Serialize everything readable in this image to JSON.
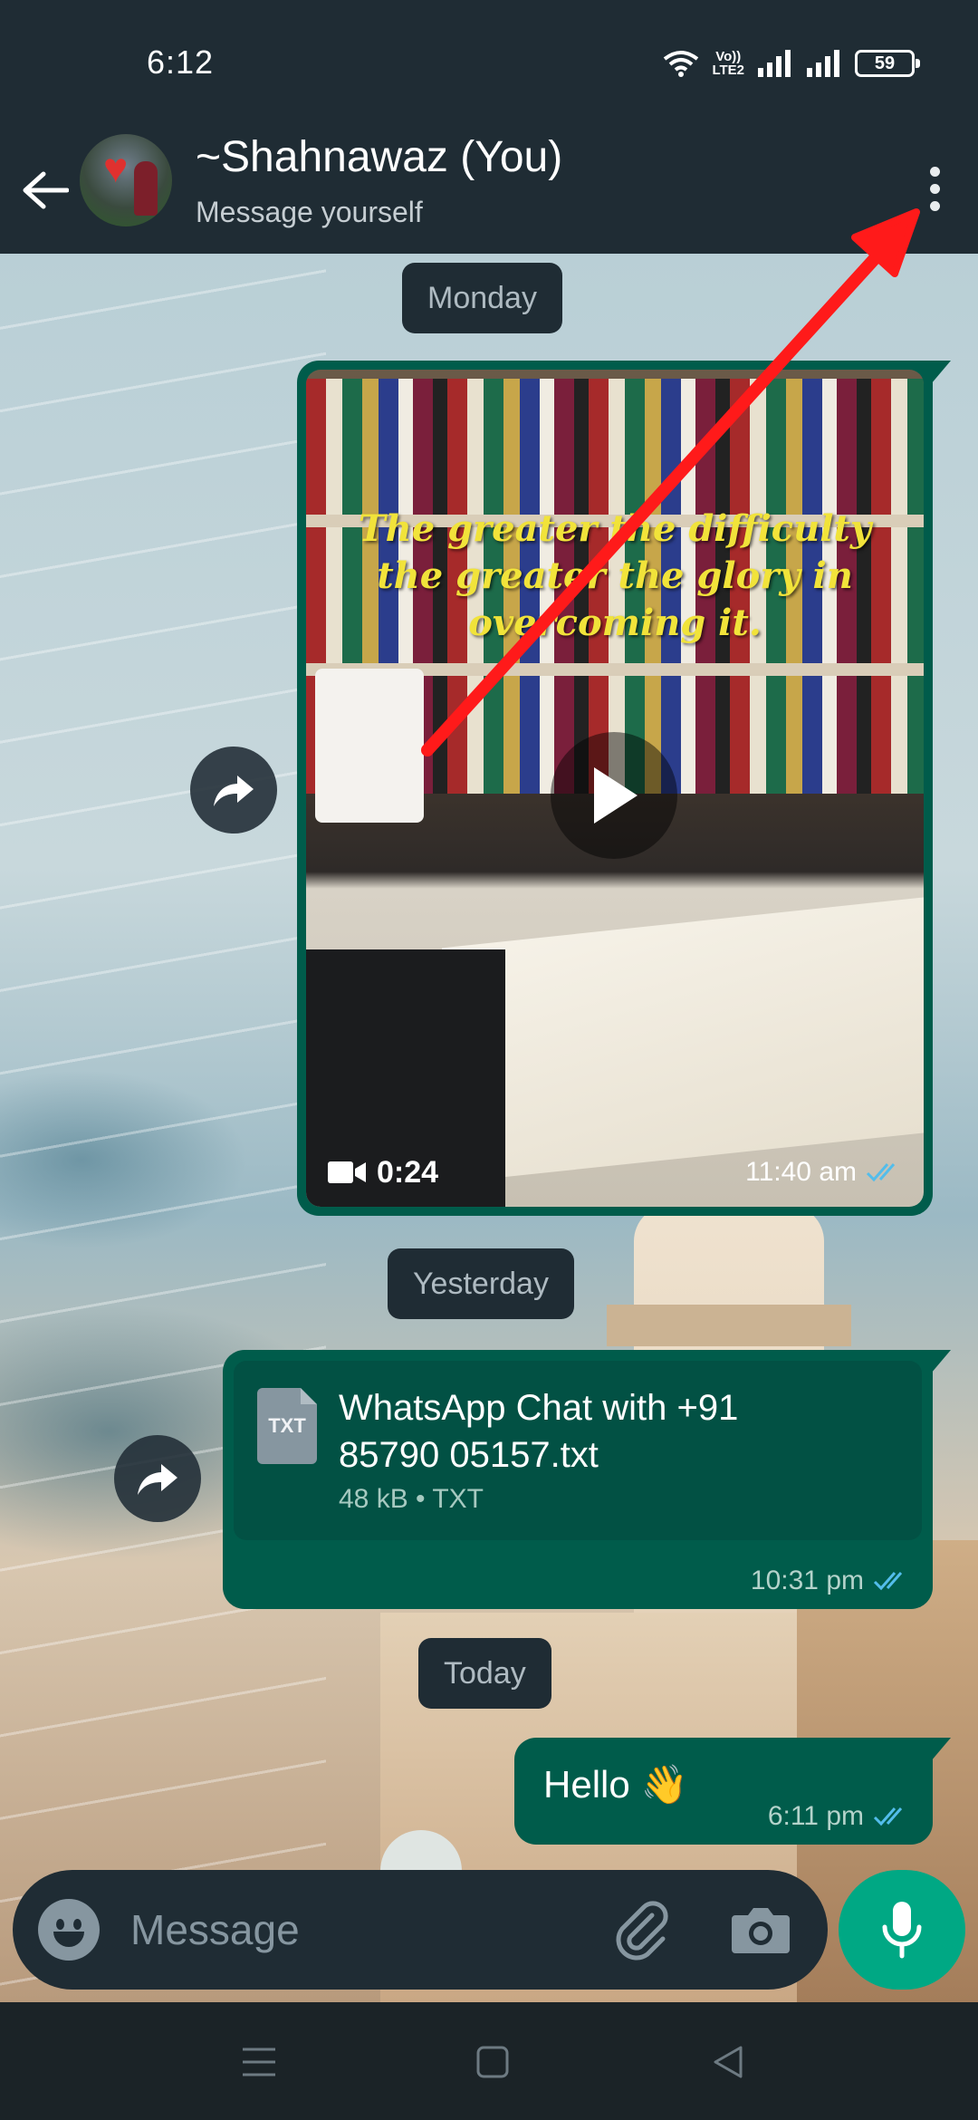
{
  "status_bar": {
    "time": "6:12",
    "volte_top": "Vo))",
    "volte_bottom": "LTE2",
    "battery": "59"
  },
  "header": {
    "contact_name": "~Shahnawaz (You)",
    "subtitle": "Message yourself"
  },
  "chat": {
    "date_monday": "Monday",
    "date_yesterday": "Yesterday",
    "date_today": "Today",
    "video_message": {
      "quote": "The greater the difficulty\nthe greater the glory in\novercoming it.",
      "duration": "0:24",
      "time": "11:40 am"
    },
    "file_message": {
      "icon_label": "TXT",
      "file_name": "WhatsApp Chat with +91\n85790 05157.txt",
      "file_info": "48 kB • TXT",
      "time": "10:31 pm"
    },
    "text_message": {
      "text": "Hello",
      "emoji": "👋",
      "time": "6:11 pm"
    }
  },
  "input": {
    "placeholder": "Message"
  },
  "colors": {
    "header_bg": "#1f2c34",
    "outgoing_bubble": "#005c4b",
    "accent_green": "#00a884",
    "read_ticks": "#53bdeb",
    "annotation_arrow": "#ff1a1a"
  },
  "icons": {
    "back": "arrow-left-icon",
    "menu": "more-vertical-icon",
    "forward": "share-forward-icon",
    "play": "play-icon",
    "video": "video-camera-icon",
    "emoji": "emoji-smiley-icon",
    "attach": "paperclip-icon",
    "camera": "camera-icon",
    "mic": "microphone-icon",
    "nav_menu": "menu-lines-icon",
    "nav_home": "square-home-icon",
    "nav_back": "triangle-back-icon"
  }
}
